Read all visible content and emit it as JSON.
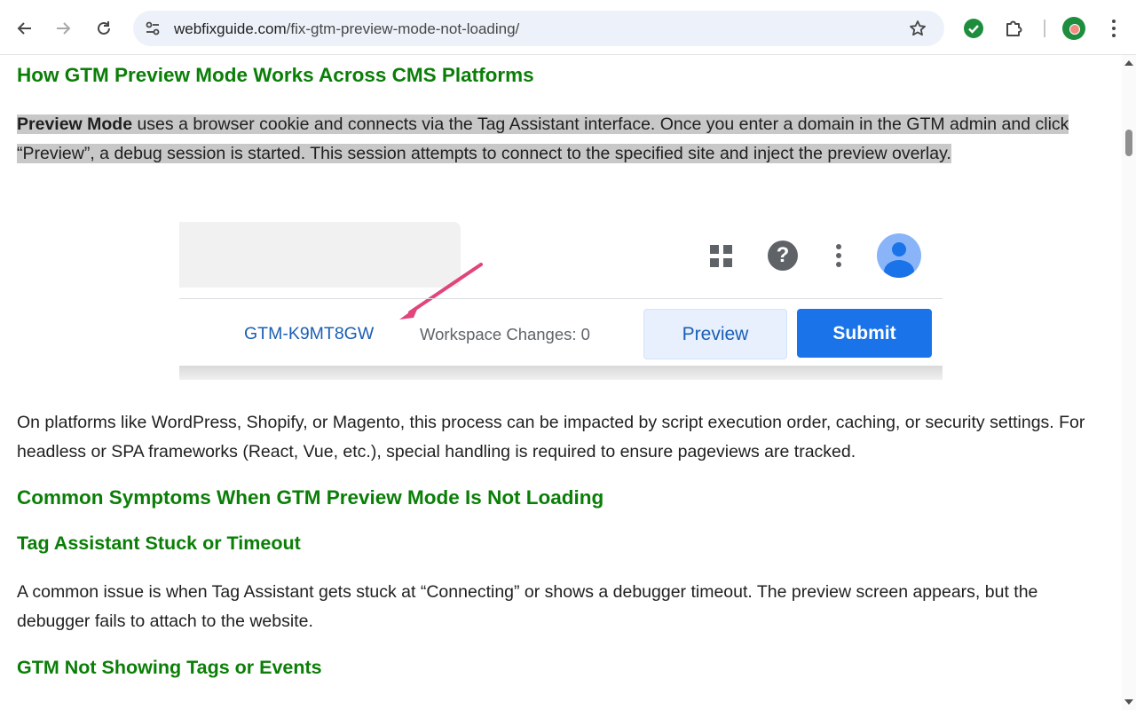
{
  "browser": {
    "url_host": "webfixguide.com",
    "url_path": "/fix-gtm-preview-mode-not-loading/",
    "colors": {
      "toolbar": "#ffffff",
      "omnibox": "#edf2fa",
      "extension_check": "#1e8e3e"
    },
    "icons": [
      "back-icon",
      "forward-icon",
      "reload-icon",
      "site-info-icon",
      "bookmark-star-icon",
      "extension-check-icon",
      "extensions-puzzle-icon",
      "profile-avatar-icon",
      "more-menu-icon"
    ]
  },
  "article": {
    "heading_platforms": "How GTM Preview Mode Works Across CMS Platforms",
    "intro_bold": "Preview Mode",
    "intro_text": " uses a browser cookie and connects via the Tag Assistant interface. Once you enter a domain in the GTM admin and click “Preview”, a debug session is started. This session attempts to connect to the specified site and inject the preview overlay.",
    "figure": {
      "container_id": "GTM-K9MT8GW",
      "workspace_changes": "Workspace Changes: 0",
      "preview_label": "Preview",
      "submit_label": "Submit",
      "help_glyph": "?",
      "icons": [
        "apps-grid-icon",
        "help-icon",
        "more-vert-icon",
        "account-icon",
        "pointer-arrow-icon"
      ]
    },
    "platforms_para": "On platforms like WordPress, Shopify, or Magento, this process can be impacted by script execution order, caching, or security settings. For headless or SPA frameworks (React, Vue, etc.), special handling is required to ensure pageviews are tracked.",
    "heading_symptoms": "Common Symptoms When GTM Preview Mode Is Not Loading",
    "heading_stuck": "Tag Assistant Stuck or Timeout",
    "stuck_para": "A common issue is when Tag Assistant gets stuck at “Connecting” or shows a debugger timeout. The preview screen appears, but the debugger fails to attach to the website.",
    "heading_tags": "GTM Not Showing Tags or Events",
    "colors": {
      "heading": "#0a7e07",
      "selection": "#c8c8c8",
      "submit": "#1a73e8"
    }
  }
}
